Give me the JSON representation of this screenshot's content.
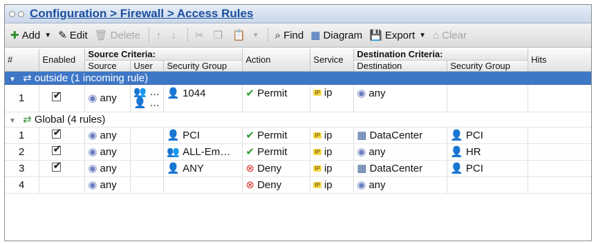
{
  "title": "Configuration > Firewall > Access Rules",
  "toolbar": {
    "add": "Add",
    "edit": "Edit",
    "delete": "Delete",
    "find": "Find",
    "diagram": "Diagram",
    "export": "Export",
    "clear": "Clear"
  },
  "columns": {
    "num": "#",
    "enabled": "Enabled",
    "source_criteria": "Source Criteria:",
    "source": "Source",
    "user": "User",
    "security_group": "Security Group",
    "action": "Action",
    "service": "Service",
    "destination_criteria": "Destination Criteria:",
    "destination": "Destination",
    "dest_security_group": "Security Group",
    "hits": "Hits"
  },
  "groups": [
    {
      "label": "outside (1 incoming rule)",
      "rules": [
        {
          "num": "1",
          "enabled": true,
          "source": "any",
          "user": "…",
          "user2": "…",
          "sg": "1044",
          "action": "Permit",
          "service": "ip",
          "dest": "any",
          "dsg": ""
        }
      ]
    },
    {
      "label": "Global (4 rules)",
      "rules": [
        {
          "num": "1",
          "enabled": true,
          "source": "any",
          "user": "",
          "sg": "PCI",
          "action": "Permit",
          "service": "ip",
          "dest": "DataCenter",
          "dsg": "PCI"
        },
        {
          "num": "2",
          "enabled": true,
          "source": "any",
          "user": "",
          "sg": "ALL-Em…",
          "action": "Permit",
          "service": "ip",
          "dest": "any",
          "dsg": "HR"
        },
        {
          "num": "3",
          "enabled": true,
          "source": "any",
          "user": "",
          "sg": "ANY",
          "action": "Deny",
          "service": "ip",
          "dest": "DataCenter",
          "dsg": "PCI"
        },
        {
          "num": "4",
          "enabled": false,
          "source": "any",
          "user": "",
          "sg": "",
          "action": "Deny",
          "service": "ip",
          "dest": "any",
          "dsg": ""
        }
      ]
    }
  ]
}
